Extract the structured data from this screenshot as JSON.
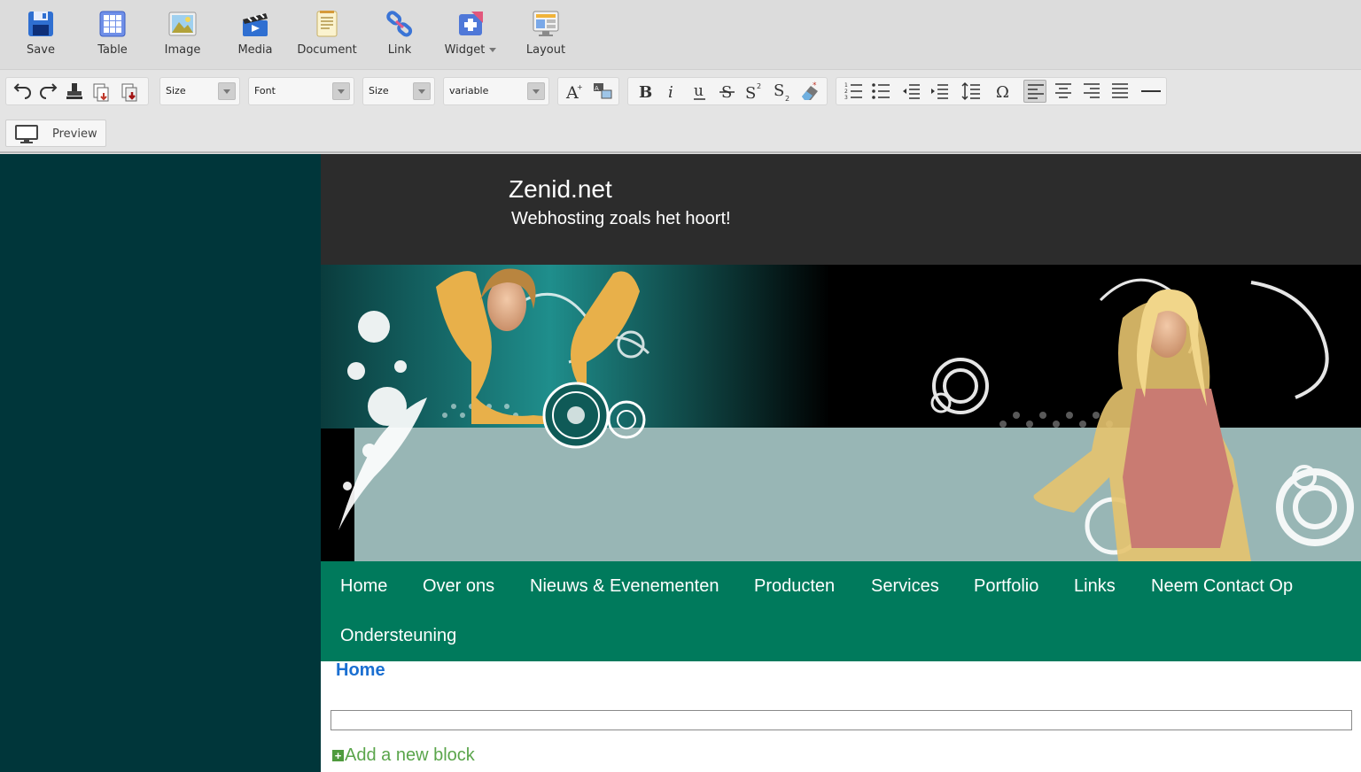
{
  "toolbar": {
    "buttons": [
      {
        "label": "Save",
        "icon": "floppy-disk-icon"
      },
      {
        "label": "Table",
        "icon": "table-grid-icon"
      },
      {
        "label": "Image",
        "icon": "image-landscape-icon"
      },
      {
        "label": "Media",
        "icon": "clapperboard-icon"
      },
      {
        "label": "Document",
        "icon": "document-icon"
      },
      {
        "label": "Link",
        "icon": "chain-link-icon"
      },
      {
        "label": "Widget",
        "icon": "widget-puzzle-icon"
      },
      {
        "label": "Layout",
        "icon": "layout-monitor-icon"
      }
    ]
  },
  "format_bar": {
    "selects": [
      {
        "value": "Size"
      },
      {
        "value": "Font"
      },
      {
        "value": "Size"
      },
      {
        "value": "variable"
      }
    ]
  },
  "preview": {
    "label": "Preview"
  },
  "site": {
    "title": "Zenid.net",
    "tagline": "Webhosting zoals het hoort!",
    "nav": [
      "Home",
      "Over ons",
      "Nieuws & Evenementen",
      "Producten",
      "Services",
      "Portfolio",
      "Links",
      "Neem Contact Op",
      "Ondersteuning"
    ],
    "breadcrumb": "Home",
    "add_block": "Add a new block"
  },
  "colors": {
    "sidebar": "#00363a",
    "header": "#2c2c2c",
    "nav": "#007a5c",
    "banner_panel": "#98b6b5",
    "breadcrumb": "#1a6fd1",
    "add_block": "#5aa54b"
  }
}
